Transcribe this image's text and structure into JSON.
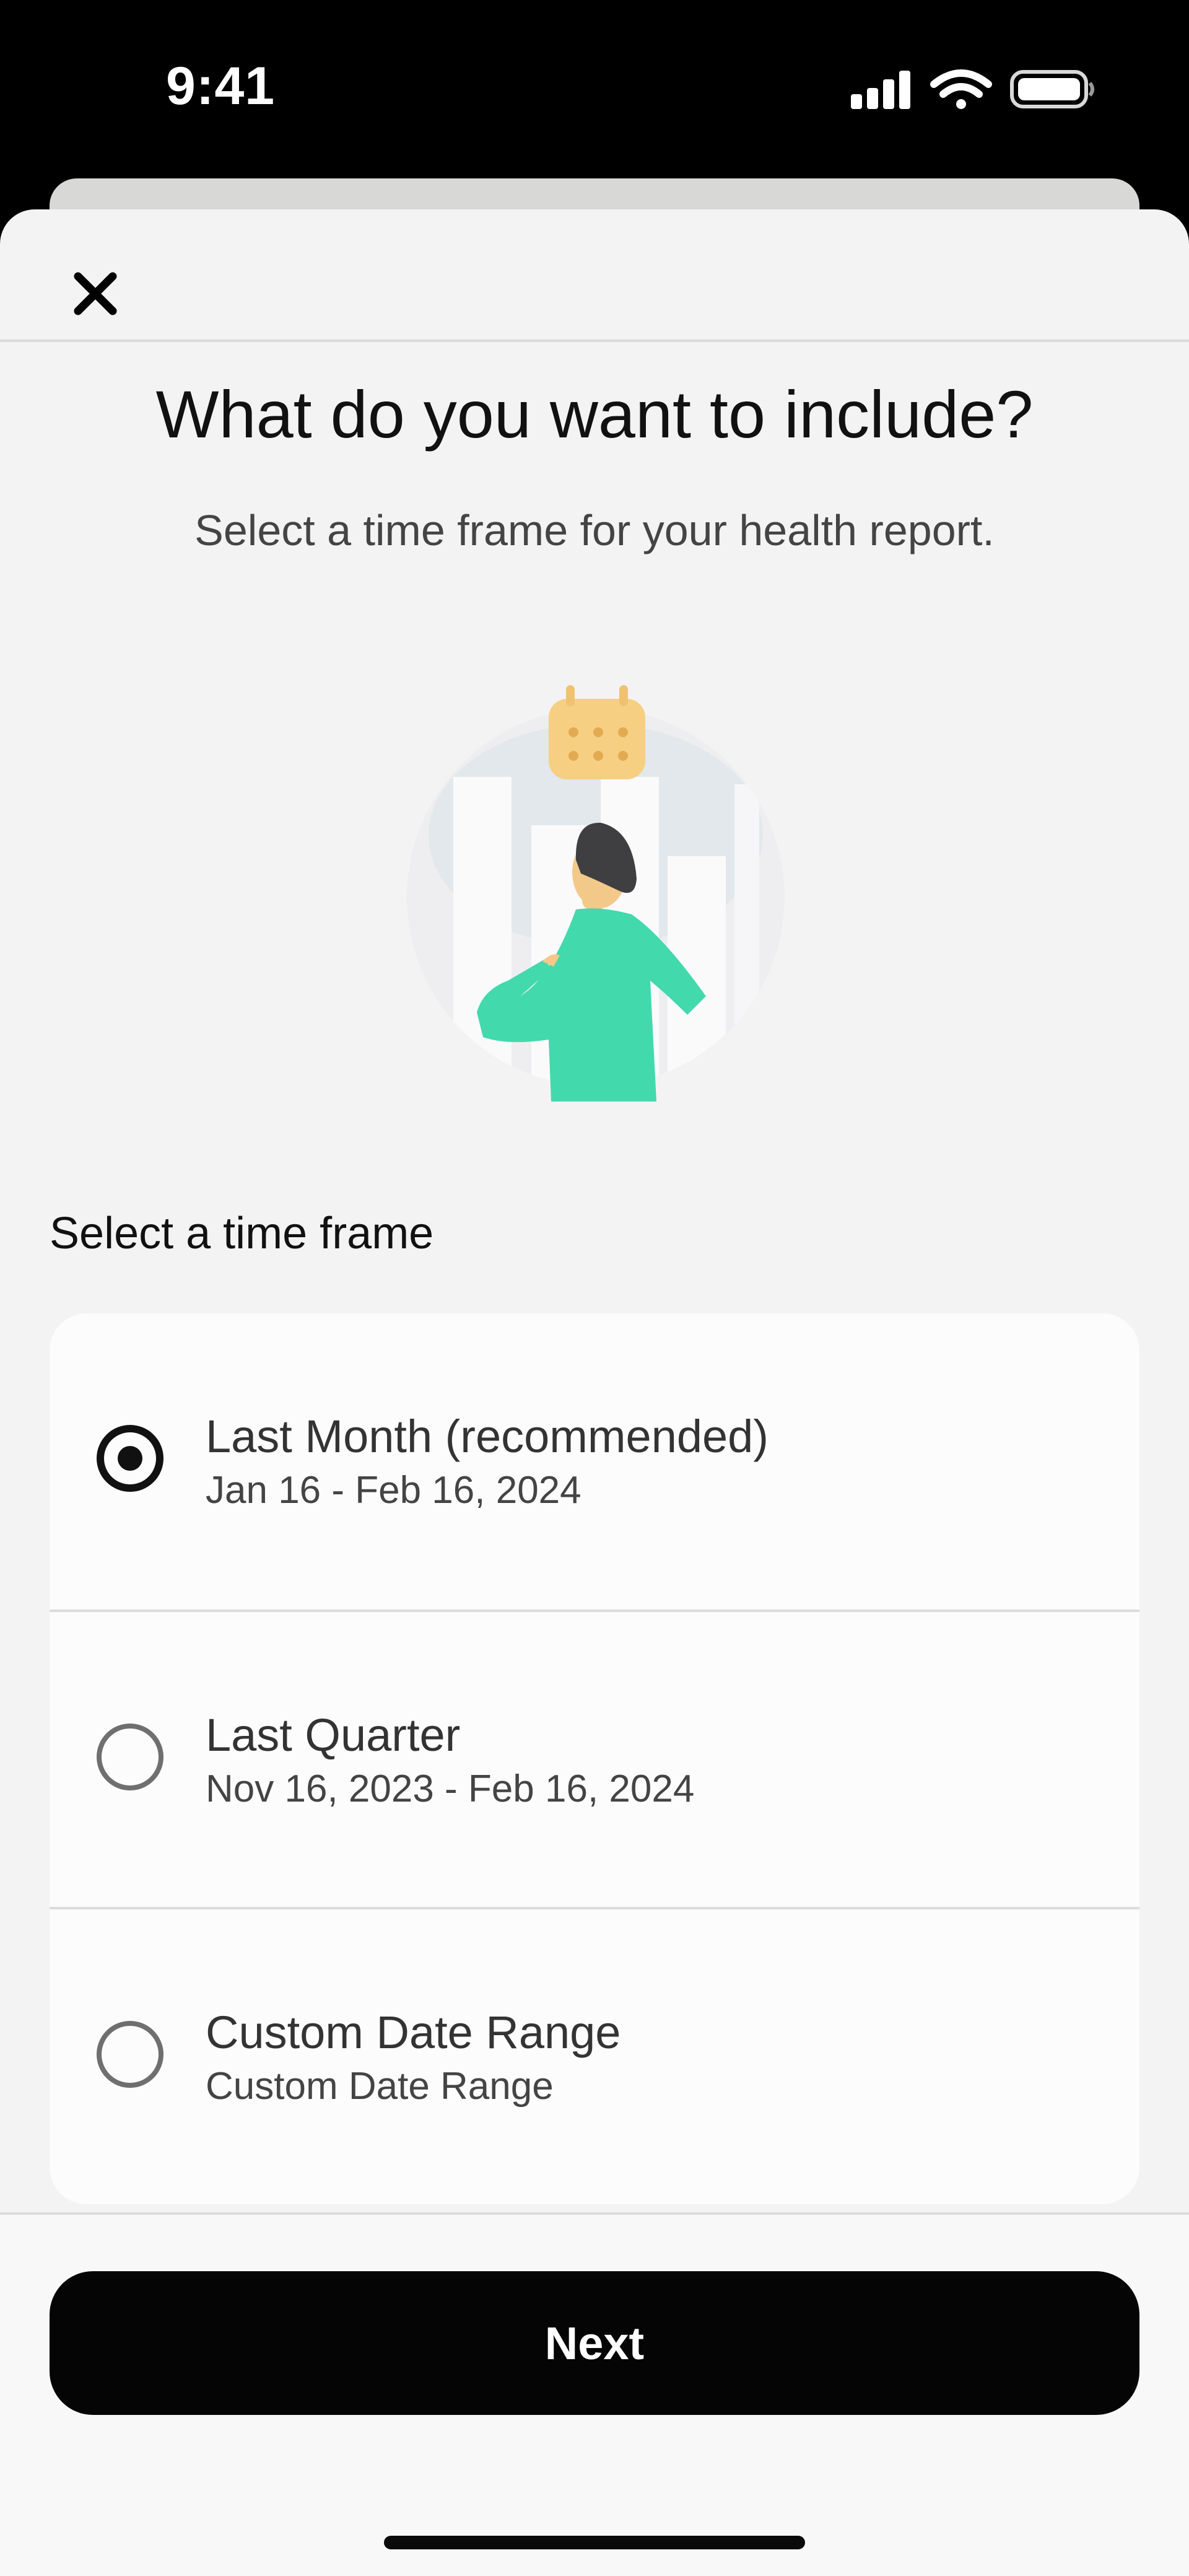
{
  "status_bar": {
    "time": "9:41",
    "icons": [
      "cellular-signal-icon",
      "wifi-icon",
      "battery-icon"
    ]
  },
  "header": {
    "close_icon": "close-icon"
  },
  "content": {
    "title": "What do you want to include?",
    "subtitle": "Select a time frame for your health report.",
    "illustration": "calendar-person-chart-illustration"
  },
  "time_frame": {
    "section_label": "Select a time frame",
    "options": [
      {
        "title": "Last Month (recommended)",
        "subtitle": "Jan 16 - Feb 16, 2024",
        "selected": true
      },
      {
        "title": "Last Quarter",
        "subtitle": "Nov 16, 2023 - Feb 16, 2024",
        "selected": false
      },
      {
        "title": "Custom Date Range",
        "subtitle": "Custom Date Range",
        "selected": false
      }
    ]
  },
  "footer": {
    "next_label": "Next"
  },
  "colors": {
    "sheet_background": "#f4f3f3",
    "card_background": "#fcfcfd",
    "primary_button": "#050505",
    "accent_green": "#42d9ad",
    "calendar_yellow": "#f6cf82"
  }
}
